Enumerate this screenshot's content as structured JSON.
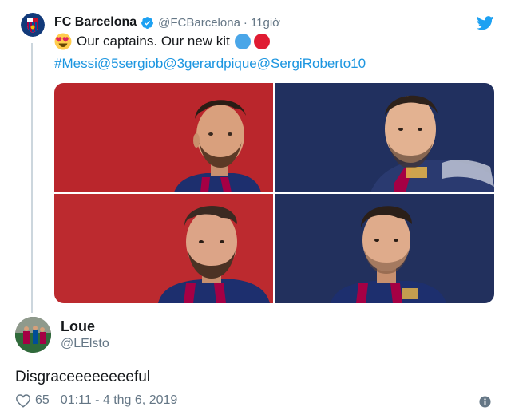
{
  "parent_tweet": {
    "author_name": "FC Barcelona",
    "author_handle": "@FCBarcelona",
    "separator": "·",
    "time": "11giờ",
    "text": "Our captains. Our new kit",
    "hashtags_mentions": "#Messi@5sergiob@3gerardpique@SergiRoberto10",
    "icons": [
      "fcb-crest-icon",
      "verified-badge-icon",
      "twitter-bird-icon",
      "heart-eyes-emoji-icon",
      "blue-circle-emoji-icon",
      "red-circle-emoji-icon"
    ],
    "photos": [
      "photo-captain-1",
      "photo-captain-2",
      "photo-captain-3",
      "photo-captain-4"
    ]
  },
  "reply": {
    "author_name": "Loue",
    "author_handle": "@LElsto",
    "text": "Disgraceeeeeeeeful",
    "likes": "65",
    "timestamp": "01:11 - 4 thg 6, 2019",
    "icons": [
      "heart-icon",
      "info-icon"
    ]
  },
  "colors": {
    "link": "#1b95e0",
    "secondary_text": "#657786",
    "thread_line": "#ccd6dd",
    "verified": "#1da1f2",
    "emoji_blue": "#4aa6e8",
    "emoji_red": "#e01b32",
    "photo_red_bg": "#b5232a",
    "photo_navy_bg": "#1f2b55"
  }
}
